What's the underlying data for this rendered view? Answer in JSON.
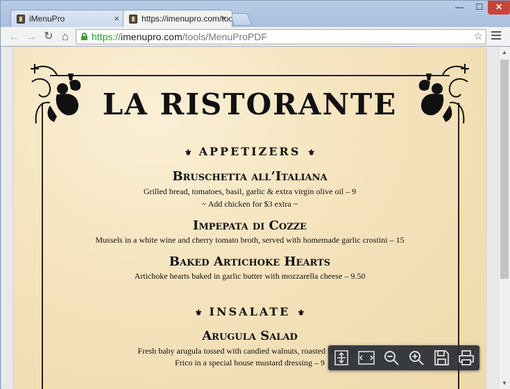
{
  "browser": {
    "tabs": [
      {
        "label": "iMenuPro",
        "active": false
      },
      {
        "label": "https://imenupro.com/too",
        "active": true
      }
    ],
    "url": {
      "scheme": "https://",
      "host": "imenupro.com",
      "path": "/tools/MenuProPDF"
    },
    "window_controls": {
      "minimize": "—",
      "maximize": "☐",
      "close": "✕"
    },
    "tab_close": "×"
  },
  "menu": {
    "title": "LA RISTORANTE",
    "sections": [
      {
        "heading": "APPETIZERS",
        "ornament": "⚜",
        "items": [
          {
            "name": "Bruschetta all’Italiana",
            "lines": [
              "Grilled bread, tomatoes, basil, garlic & extra virgin olive oil – 9",
              "~ Add chicken for $3 extra ~"
            ]
          },
          {
            "name": "Impepata di Cozze",
            "lines": [
              "Mussels in a white wine and cherry tomato broth, served with homemade garlic crostini – 15"
            ]
          },
          {
            "name": "Baked Artichoke Hearts",
            "lines": [
              "Artichoke hearts baked in garlic butter with mozzarella cheese – 9.50"
            ]
          }
        ]
      },
      {
        "heading": "INSALATE",
        "ornament": "⚜",
        "items": [
          {
            "name": "Arugula Salad",
            "lines": [
              "Fresh baby arugula tossed with candied walnuts, roasted beets, drie",
              "Frico in a special house mustard dressing – 9"
            ]
          }
        ]
      }
    ]
  },
  "pdf_toolbar": {
    "buttons": [
      "fit-page-icon",
      "fit-width-icon",
      "zoom-out-icon",
      "zoom-in-icon",
      "save-icon",
      "print-icon"
    ]
  },
  "colors": {
    "parchment": "#f5e4bf",
    "ink": "#111111",
    "secure_green": "#2a9a2a",
    "toolbar_bg": "#282c34"
  }
}
